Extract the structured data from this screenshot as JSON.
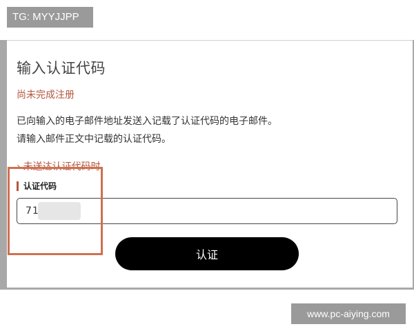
{
  "tags": {
    "top": "TG: MYYJJPP",
    "watermark": "www.pc-aiying.com"
  },
  "form": {
    "title": "输入认证代码",
    "status": "尚未完成注册",
    "description_line1": "已向输入的电子邮件地址发送入记载了认证代码的电子邮件。",
    "description_line2": "请输入邮件正文中记载的认证代码。",
    "not_received_link": "未送达认证代码时",
    "chevron_icon": "chevron-right",
    "code_label": "认证代码",
    "code_value": "71",
    "submit_label": "认证"
  },
  "colors": {
    "accent": "#b3563e",
    "highlight_box": "#cf6f50",
    "button": "#000000"
  }
}
